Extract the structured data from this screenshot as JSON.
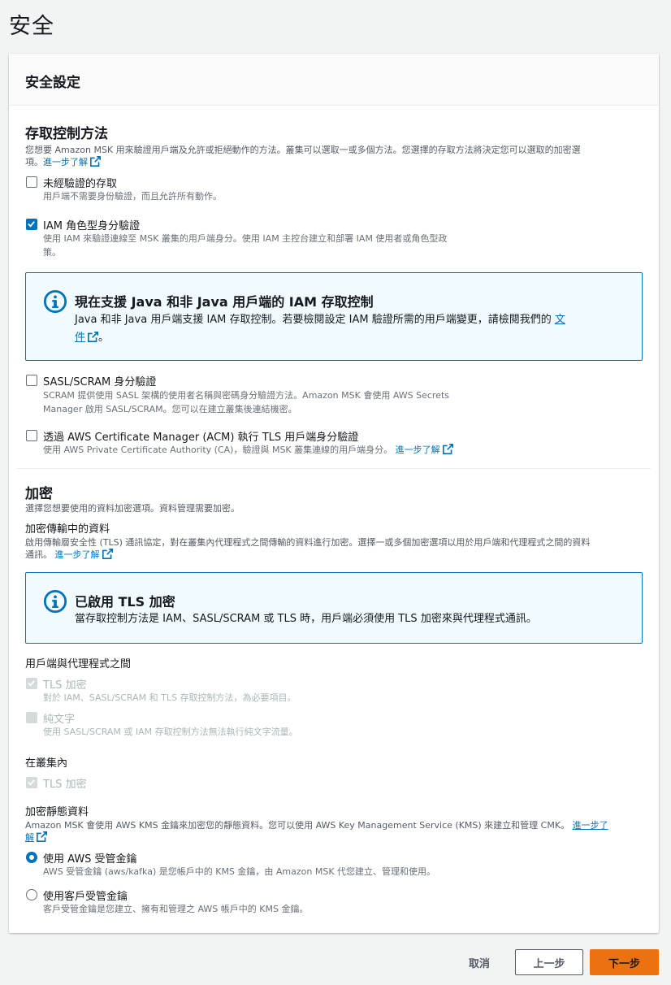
{
  "page": {
    "title": "安全"
  },
  "card": {
    "title": "安全設定"
  },
  "access": {
    "heading": "存取控制方法",
    "desc_line1": "您想要 Amazon MSK 用來驗證用戶端及允許或拒絕動作的方法。叢集可以選取一或多個方法。您選擇的存取方法將決定您可以選取的加密選",
    "desc_line2": "項。",
    "learn_more": "進一步了解",
    "options": [
      {
        "label": "未經驗證的存取",
        "desc": "用戶端不需要身份驗證，而且允許所有動作。",
        "checked": false
      },
      {
        "label": "IAM 角色型身分驗證",
        "desc_line1": "使用 IAM 來驗證連線至 MSK 叢集的用戶端身分。使用 IAM 主控台建立和部署 IAM 使用者或角色型政",
        "desc_line2": "策。",
        "checked": true
      },
      {
        "label": "SASL/SCRAM 身分驗證",
        "desc_line1": "SCRAM 提供使用 SASL 架構的使用者名稱與密碼身分驗證方法。Amazon MSK 會使用 AWS Secrets",
        "desc_line2": "Manager 啟用 SASL/SCRAM。您可以在建立叢集後連結機密。",
        "checked": false
      },
      {
        "label": "透過 AWS Certificate Manager (ACM) 執行 TLS 用戶端身分驗證",
        "desc": "使用 AWS Private Certificate Authority (CA)，驗證與 MSK 叢集連線的用戶端身分。",
        "learn_more": "進一步了解",
        "checked": false
      }
    ],
    "info": {
      "title": "現在支援 Java 和非 Java 用戶端的 IAM 存取控制",
      "body_line1": "Java 和非 Java 用戶端支援 IAM 存取控制。若要檢閱設定 IAM 驗證所需的用戶端變更，請檢閱我們的",
      "link_part1": "文",
      "link_part2": "件",
      "body_end": "。"
    }
  },
  "encryption": {
    "heading": "加密",
    "desc": "選擇您想要使用的資料加密選項。資料管理需要加密。",
    "transit_label": "加密傳輸中的資料",
    "transit_desc_line1": "啟用傳輸層安全性 (TLS) 通訊協定，對在叢集內代理程式之間傳輸的資料進行加密。選擇一或多個加密選項以用於用戶端和代理程式之間的資料",
    "transit_desc_line2": "通訊。",
    "learn_more": "進一步了解",
    "info": {
      "title": "已啟用 TLS 加密",
      "body": "當存取控制方法是 IAM、SASL/SCRAM 或 TLS 時，用戶端必須使用 TLS 加密來與代理程式通訊。"
    },
    "client_broker": {
      "label": "用戶端與代理程式之間",
      "tls_label": "TLS 加密",
      "tls_desc": "對於 IAM、SASL/SCRAM 和 TLS 存取控制方法，為必要項目。",
      "plain_label": "純文字",
      "plain_desc": "使用 SASL/SCRAM 或 IAM 存取控制方法無法執行純文字流量。"
    },
    "in_cluster": {
      "label": "在叢集內",
      "tls_label": "TLS 加密"
    },
    "at_rest": {
      "label": "加密靜態資料",
      "desc_line1": "Amazon MSK 會使用 AWS KMS 金鑰來加密您的靜態資料。您可以使用 AWS Key Management Service (KMS) 來建立和管理 CMK。",
      "learn_more_part1": "進一步了",
      "learn_more_part2": "解",
      "aws_key_label": "使用 AWS 受管金鑰",
      "aws_key_desc": "AWS 受管金鑰 (aws/kafka) 是您帳戶中的 KMS 金鑰，由 Amazon MSK 代您建立、管理和使用。",
      "customer_key_label": "使用客戶受管金鑰",
      "customer_key_desc": "客戶受管金鑰是您建立、擁有和管理之 AWS 帳戶中的 KMS 金鑰。",
      "selected": "aws"
    }
  },
  "footer": {
    "cancel": "取消",
    "previous": "上一步",
    "next": "下一步"
  },
  "colors": {
    "accent": "#0073bb",
    "primary_button": "#ec7211",
    "info_bg": "#f1faff"
  }
}
